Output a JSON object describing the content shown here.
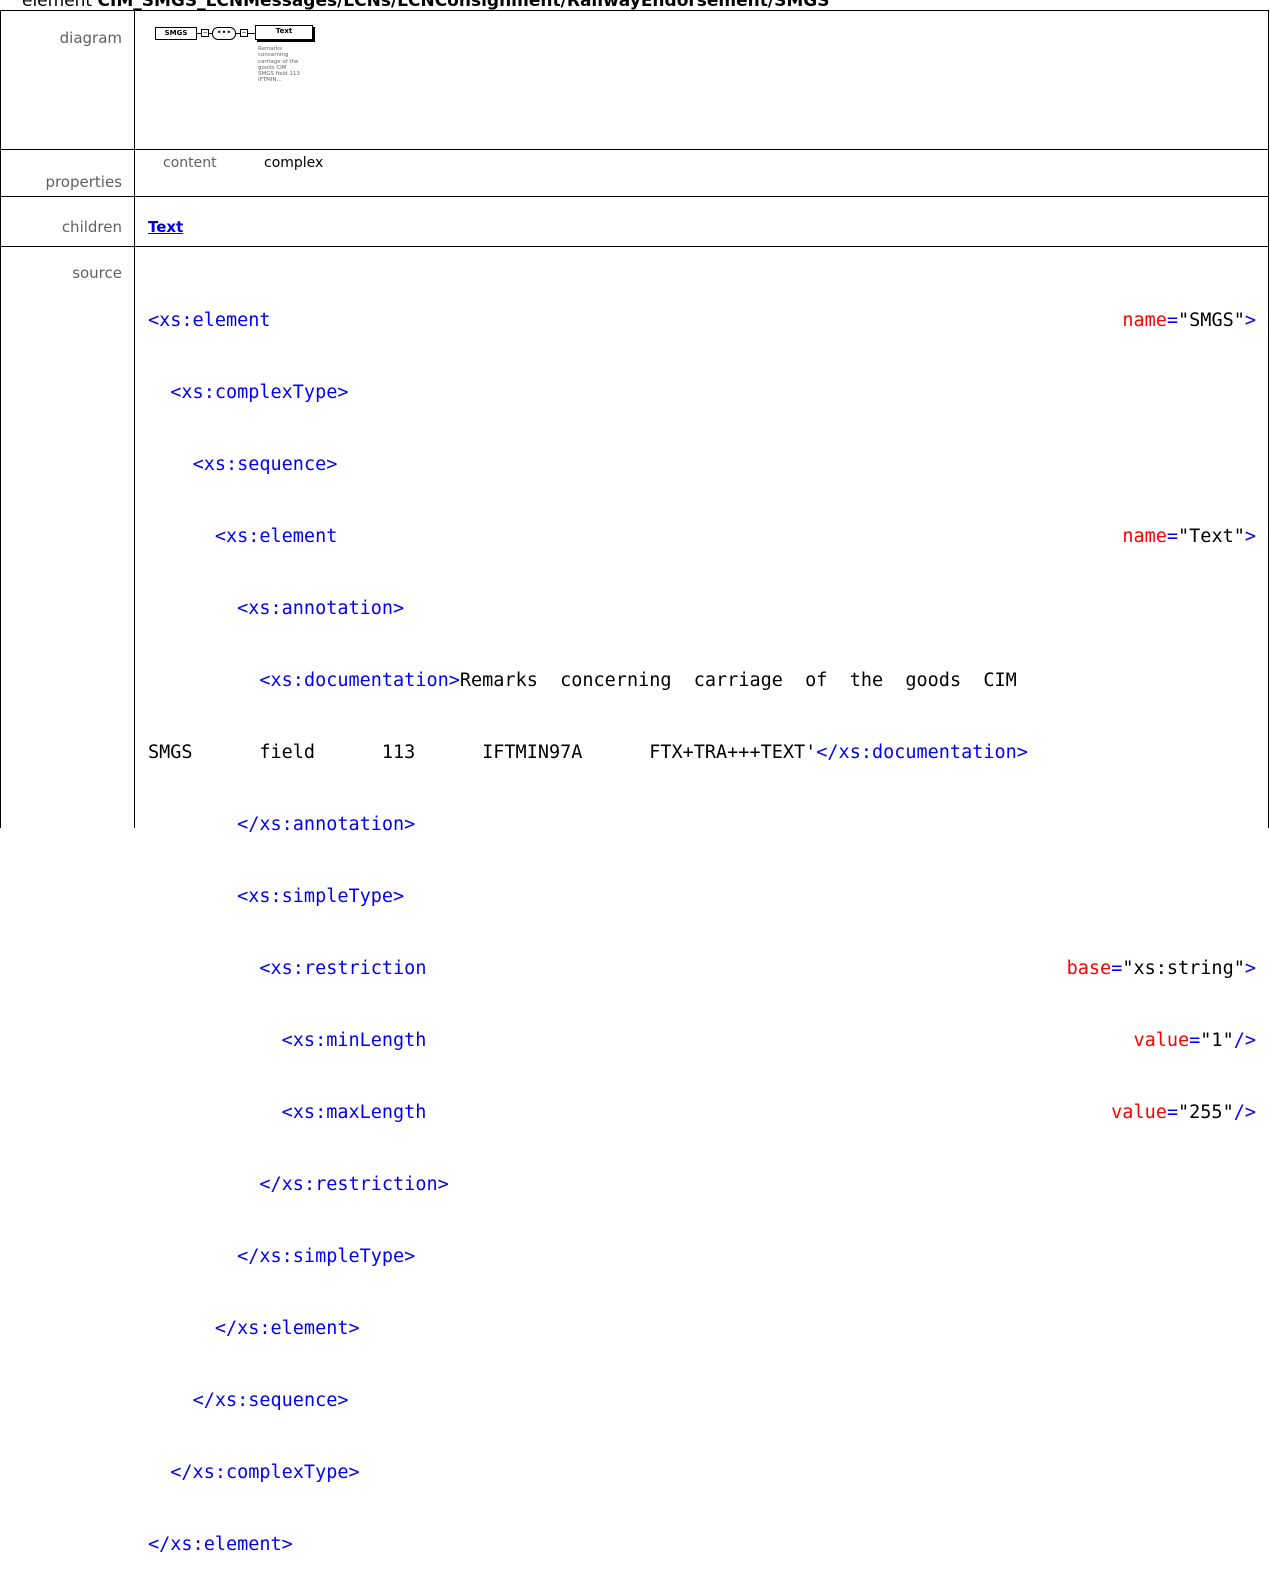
{
  "header": {
    "prefix": "element",
    "path": "CIM_SMGS_LCNMessages/LCNs/LCNConsignment/RailwayEndorsement/SMGS"
  },
  "rows": {
    "diagram_label": "diagram",
    "properties_label": "properties",
    "children_label": "children",
    "source_label": "source"
  },
  "diagram": {
    "element_name": "SMGS",
    "sequence_symbol": "•••",
    "child_name": "Text",
    "doc_text": "Remarks concerning carriage of the goods CIM SMGS field 113 IFTMIN..."
  },
  "properties": {
    "key": "content",
    "value": "complex"
  },
  "children": {
    "link": "Text"
  },
  "source": {
    "l1_tag": "<xs:element",
    "l1_attr": "name",
    "l1_val": "\"SMGS\"",
    "l1_end": ">",
    "l2": "<xs:complexType>",
    "l3": "<xs:sequence>",
    "l4_tag": "<xs:element",
    "l4_attr": "name",
    "l4_val": "\"Text\"",
    "l4_end": ">",
    "l5": "<xs:annotation>",
    "l6_tag": "<xs:documentation>",
    "l6_text": "Remarks  concerning  carriage  of  the  goods  CIM",
    "l7_text": "SMGS      field      113      IFTMIN97A      FTX+TRA+++TEXT'",
    "l7_close": "</xs:documentation>",
    "l8": "</xs:annotation>",
    "l9": "<xs:simpleType>",
    "l10_tag": "<xs:restriction",
    "l10_attr": "base",
    "l10_val": "\"xs:string\"",
    "l10_end": ">",
    "l11_tag": "<xs:minLength",
    "l11_attr": "value",
    "l11_val": "\"1\"",
    "l11_end": "/>",
    "l12_tag": "<xs:maxLength",
    "l12_attr": "value",
    "l12_val": "\"255\"",
    "l12_end": "/>",
    "l13": "</xs:restriction>",
    "l14": "</xs:simpleType>",
    "l15": "</xs:element>",
    "l16": "</xs:sequence>",
    "l17": "</xs:complexType>",
    "l18": "</xs:element>",
    "eq": "="
  }
}
